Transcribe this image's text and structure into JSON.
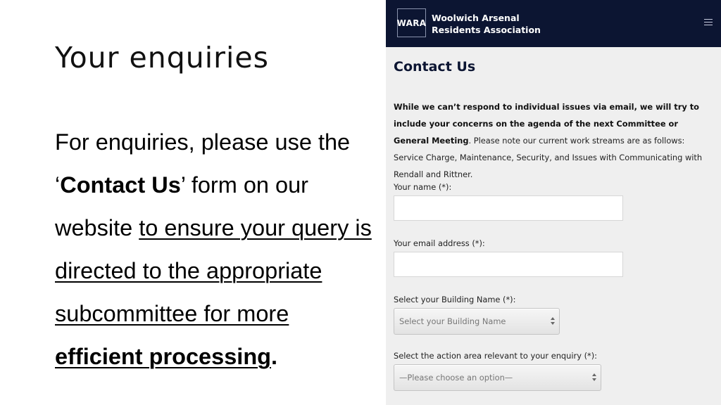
{
  "slide": {
    "title": "Your enquiries",
    "body": {
      "part1": "For enquiries, please use the ‘",
      "contact_bold": "Contact Us",
      "part2": "’ form on our website ",
      "underlined": "to ensure your query is directed to the appropriate subcommittee for more ",
      "underlined_bold": "efficient processing",
      "end": "."
    }
  },
  "site": {
    "logo": "WARA",
    "org_name_line1": "Woolwich Arsenal",
    "org_name_line2": "Residents Association",
    "menu_icon": "hamburger-menu-icon",
    "page_title": "Contact Us",
    "intro_bold": "While we can’t respond to individual issues via email, we will try to include your concerns on the agenda of the next Committee or General Meeting",
    "intro_rest": ". Please note our current work streams are as follows: Service Charge, Maintenance, Security, and Issues with Communicating with Rendall and Rittner.",
    "form": {
      "name_label": "Your name (*):",
      "name_value": "",
      "email_label": "Your email address (*):",
      "email_value": "",
      "building_label": "Select your Building Name (*):",
      "building_selected": "Select your Building Name",
      "action_label": "Select the action area relevant to your enquiry (*):",
      "action_selected": "—Please choose an option—"
    }
  },
  "colors": {
    "header_bg": "#0c1532",
    "page_bg": "#efefef",
    "title_color": "#0c1532"
  }
}
